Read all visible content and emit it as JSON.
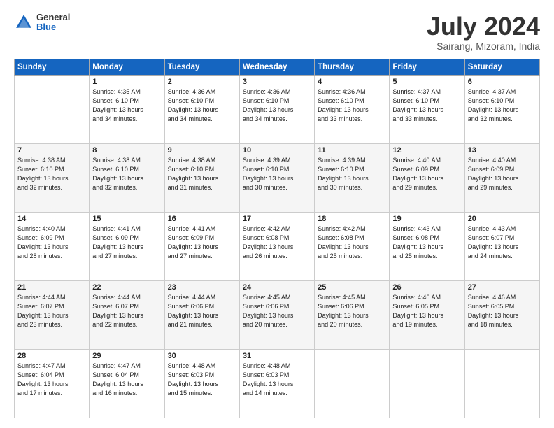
{
  "logo": {
    "general": "General",
    "blue": "Blue"
  },
  "title": "July 2024",
  "subtitle": "Sairang, Mizoram, India",
  "weekdays": [
    "Sunday",
    "Monday",
    "Tuesday",
    "Wednesday",
    "Thursday",
    "Friday",
    "Saturday"
  ],
  "weeks": [
    [
      {
        "day": "",
        "info": ""
      },
      {
        "day": "1",
        "info": "Sunrise: 4:35 AM\nSunset: 6:10 PM\nDaylight: 13 hours\nand 34 minutes."
      },
      {
        "day": "2",
        "info": "Sunrise: 4:36 AM\nSunset: 6:10 PM\nDaylight: 13 hours\nand 34 minutes."
      },
      {
        "day": "3",
        "info": "Sunrise: 4:36 AM\nSunset: 6:10 PM\nDaylight: 13 hours\nand 34 minutes."
      },
      {
        "day": "4",
        "info": "Sunrise: 4:36 AM\nSunset: 6:10 PM\nDaylight: 13 hours\nand 33 minutes."
      },
      {
        "day": "5",
        "info": "Sunrise: 4:37 AM\nSunset: 6:10 PM\nDaylight: 13 hours\nand 33 minutes."
      },
      {
        "day": "6",
        "info": "Sunrise: 4:37 AM\nSunset: 6:10 PM\nDaylight: 13 hours\nand 32 minutes."
      }
    ],
    [
      {
        "day": "7",
        "info": "Sunrise: 4:38 AM\nSunset: 6:10 PM\nDaylight: 13 hours\nand 32 minutes."
      },
      {
        "day": "8",
        "info": "Sunrise: 4:38 AM\nSunset: 6:10 PM\nDaylight: 13 hours\nand 32 minutes."
      },
      {
        "day": "9",
        "info": "Sunrise: 4:38 AM\nSunset: 6:10 PM\nDaylight: 13 hours\nand 31 minutes."
      },
      {
        "day": "10",
        "info": "Sunrise: 4:39 AM\nSunset: 6:10 PM\nDaylight: 13 hours\nand 30 minutes."
      },
      {
        "day": "11",
        "info": "Sunrise: 4:39 AM\nSunset: 6:10 PM\nDaylight: 13 hours\nand 30 minutes."
      },
      {
        "day": "12",
        "info": "Sunrise: 4:40 AM\nSunset: 6:09 PM\nDaylight: 13 hours\nand 29 minutes."
      },
      {
        "day": "13",
        "info": "Sunrise: 4:40 AM\nSunset: 6:09 PM\nDaylight: 13 hours\nand 29 minutes."
      }
    ],
    [
      {
        "day": "14",
        "info": "Sunrise: 4:40 AM\nSunset: 6:09 PM\nDaylight: 13 hours\nand 28 minutes."
      },
      {
        "day": "15",
        "info": "Sunrise: 4:41 AM\nSunset: 6:09 PM\nDaylight: 13 hours\nand 27 minutes."
      },
      {
        "day": "16",
        "info": "Sunrise: 4:41 AM\nSunset: 6:09 PM\nDaylight: 13 hours\nand 27 minutes."
      },
      {
        "day": "17",
        "info": "Sunrise: 4:42 AM\nSunset: 6:08 PM\nDaylight: 13 hours\nand 26 minutes."
      },
      {
        "day": "18",
        "info": "Sunrise: 4:42 AM\nSunset: 6:08 PM\nDaylight: 13 hours\nand 25 minutes."
      },
      {
        "day": "19",
        "info": "Sunrise: 4:43 AM\nSunset: 6:08 PM\nDaylight: 13 hours\nand 25 minutes."
      },
      {
        "day": "20",
        "info": "Sunrise: 4:43 AM\nSunset: 6:07 PM\nDaylight: 13 hours\nand 24 minutes."
      }
    ],
    [
      {
        "day": "21",
        "info": "Sunrise: 4:44 AM\nSunset: 6:07 PM\nDaylight: 13 hours\nand 23 minutes."
      },
      {
        "day": "22",
        "info": "Sunrise: 4:44 AM\nSunset: 6:07 PM\nDaylight: 13 hours\nand 22 minutes."
      },
      {
        "day": "23",
        "info": "Sunrise: 4:44 AM\nSunset: 6:06 PM\nDaylight: 13 hours\nand 21 minutes."
      },
      {
        "day": "24",
        "info": "Sunrise: 4:45 AM\nSunset: 6:06 PM\nDaylight: 13 hours\nand 20 minutes."
      },
      {
        "day": "25",
        "info": "Sunrise: 4:45 AM\nSunset: 6:06 PM\nDaylight: 13 hours\nand 20 minutes."
      },
      {
        "day": "26",
        "info": "Sunrise: 4:46 AM\nSunset: 6:05 PM\nDaylight: 13 hours\nand 19 minutes."
      },
      {
        "day": "27",
        "info": "Sunrise: 4:46 AM\nSunset: 6:05 PM\nDaylight: 13 hours\nand 18 minutes."
      }
    ],
    [
      {
        "day": "28",
        "info": "Sunrise: 4:47 AM\nSunset: 6:04 PM\nDaylight: 13 hours\nand 17 minutes."
      },
      {
        "day": "29",
        "info": "Sunrise: 4:47 AM\nSunset: 6:04 PM\nDaylight: 13 hours\nand 16 minutes."
      },
      {
        "day": "30",
        "info": "Sunrise: 4:48 AM\nSunset: 6:03 PM\nDaylight: 13 hours\nand 15 minutes."
      },
      {
        "day": "31",
        "info": "Sunrise: 4:48 AM\nSunset: 6:03 PM\nDaylight: 13 hours\nand 14 minutes."
      },
      {
        "day": "",
        "info": ""
      },
      {
        "day": "",
        "info": ""
      },
      {
        "day": "",
        "info": ""
      }
    ]
  ]
}
